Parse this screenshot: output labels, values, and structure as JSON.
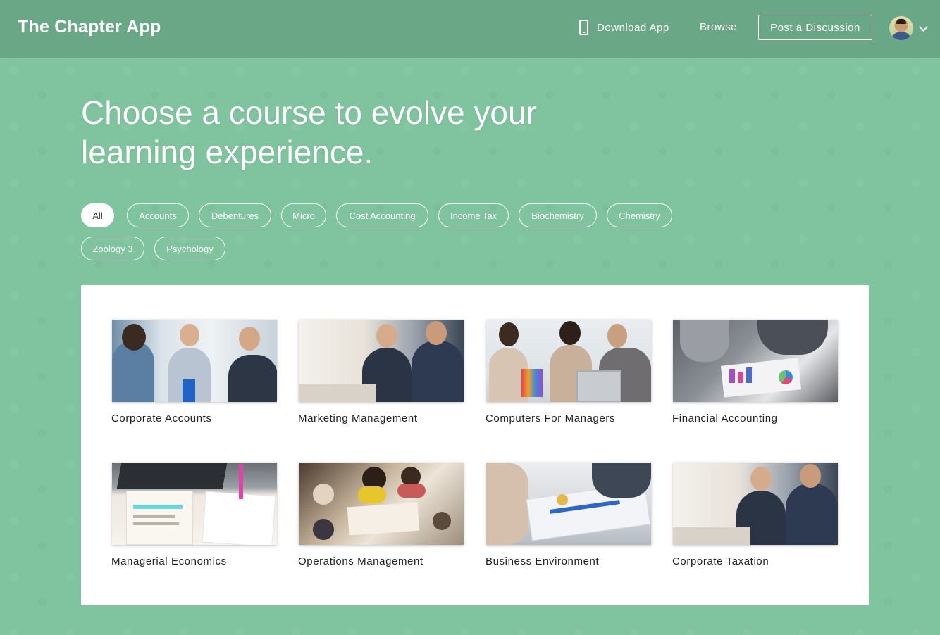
{
  "header": {
    "brand": "The Chapter App",
    "download_label": "Download App",
    "browse_label": "Browse",
    "post_label": "Post a Discussion"
  },
  "hero": {
    "line1": "Choose a course to evolve your",
    "line2": "learning experience."
  },
  "filters": [
    {
      "label": "All",
      "active": true
    },
    {
      "label": "Accounts"
    },
    {
      "label": "Debentures"
    },
    {
      "label": "Micro"
    },
    {
      "label": "Cost Accounting"
    },
    {
      "label": "Income Tax"
    },
    {
      "label": "Biochemistry"
    },
    {
      "label": "Chemistry"
    },
    {
      "label": "Zoology 3"
    },
    {
      "label": "Psychology"
    }
  ],
  "courses": [
    {
      "title": "Corporate Accounts"
    },
    {
      "title": "Marketing Management"
    },
    {
      "title": "Computers For Managers"
    },
    {
      "title": "Financial Accounting"
    },
    {
      "title": "Managerial Economics"
    },
    {
      "title": "Operations Management"
    },
    {
      "title": "Business Environment"
    },
    {
      "title": "Corporate Taxation"
    }
  ],
  "colors": {
    "background": "#80c39f",
    "header": "#6aa787",
    "panel": "#ffffff"
  }
}
